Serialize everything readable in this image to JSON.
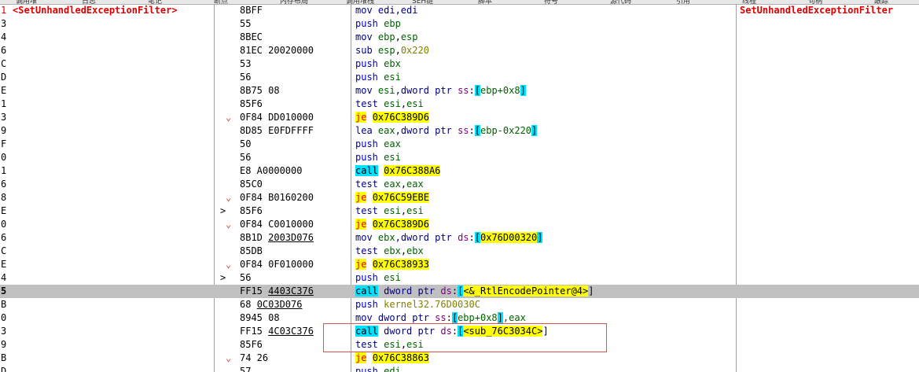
{
  "toolbar": {
    "tabs": [
      "调用堆",
      "日志",
      "笔记",
      "断点",
      "内存布局",
      "调用堆栈",
      "SEH链",
      "脚本",
      "符号",
      "源代码",
      "引用",
      "线程",
      "句柄",
      "跟踪"
    ]
  },
  "comment_header": "SetUnhandledExceptionFilter",
  "rows": [
    {
      "idx": "1",
      "fn": "<SetUnhandledExceptionFilter>",
      "gut": "",
      "hex": [
        {
          "t": "8BFF"
        }
      ],
      "dis": [
        {
          "t": "mov edi,edi",
          "c": "kw"
        }
      ],
      "cmt": "SetUnhandledExceptionFilter"
    },
    {
      "idx": "3",
      "gut": "",
      "hex": [
        {
          "t": "55"
        }
      ],
      "dis": [
        {
          "t": "push ",
          "c": "mn-push"
        },
        {
          "t": "ebp",
          "c": "reg"
        }
      ]
    },
    {
      "idx": "4",
      "gut": "",
      "hex": [
        {
          "t": "8BEC"
        }
      ],
      "dis": [
        {
          "t": "mov ",
          "c": "kw"
        },
        {
          "t": "ebp",
          "c": "reg"
        },
        {
          "t": ",",
          "c": ""
        },
        {
          "t": "esp",
          "c": "reg"
        }
      ]
    },
    {
      "idx": "6",
      "gut": "",
      "hex": [
        {
          "t": "81EC 20020000"
        }
      ],
      "dis": [
        {
          "t": "sub ",
          "c": "kw"
        },
        {
          "t": "esp",
          "c": "reg"
        },
        {
          "t": ",",
          "c": ""
        },
        {
          "t": "0x220",
          "c": "imm"
        }
      ]
    },
    {
      "idx": "C",
      "gut": "",
      "hex": [
        {
          "t": "53"
        }
      ],
      "dis": [
        {
          "t": "push ",
          "c": "mn-push"
        },
        {
          "t": "ebx",
          "c": "reg"
        }
      ]
    },
    {
      "idx": "D",
      "gut": "",
      "hex": [
        {
          "t": "56"
        }
      ],
      "dis": [
        {
          "t": "push ",
          "c": "mn-push"
        },
        {
          "t": "esi",
          "c": "reg"
        }
      ]
    },
    {
      "idx": "E",
      "gut": "",
      "hex": [
        {
          "t": "8B75 08"
        }
      ],
      "dis": [
        {
          "t": "mov ",
          "c": "kw"
        },
        {
          "t": "esi",
          "c": "reg"
        },
        {
          "t": ",dword ptr ",
          "c": "kw"
        },
        {
          "t": "ss",
          "c": "seg"
        },
        {
          "t": ":",
          "c": ""
        },
        {
          "t": "[",
          "c": "br"
        },
        {
          "t": "ebp+0x8",
          "c": "reg"
        },
        {
          "t": "]",
          "c": "br"
        }
      ]
    },
    {
      "idx": "1",
      "gut": "",
      "hex": [
        {
          "t": "85F6"
        }
      ],
      "dis": [
        {
          "t": "test ",
          "c": "kw"
        },
        {
          "t": "esi",
          "c": "reg"
        },
        {
          "t": ",",
          "c": ""
        },
        {
          "t": "esi",
          "c": "reg"
        }
      ]
    },
    {
      "idx": "3",
      "gut": "⌄",
      "hex": [
        {
          "t": "0F84 DD010000"
        }
      ],
      "dis": [
        {
          "t": "je",
          "c": "tag-je"
        },
        {
          "t": " ",
          "c": ""
        },
        {
          "t": "0x76C389D6",
          "c": "hl"
        }
      ]
    },
    {
      "idx": "9",
      "gut": "",
      "hex": [
        {
          "t": "8D85 E0FDFFFF"
        }
      ],
      "dis": [
        {
          "t": "lea ",
          "c": "kw"
        },
        {
          "t": "eax",
          "c": "reg"
        },
        {
          "t": ",dword ptr ",
          "c": "kw"
        },
        {
          "t": "ss",
          "c": "seg"
        },
        {
          "t": ":",
          "c": ""
        },
        {
          "t": "[",
          "c": "br"
        },
        {
          "t": "ebp-0x220",
          "c": "reg"
        },
        {
          "t": "]",
          "c": "br"
        }
      ]
    },
    {
      "idx": "F",
      "gut": "",
      "hex": [
        {
          "t": "50"
        }
      ],
      "dis": [
        {
          "t": "push ",
          "c": "mn-push"
        },
        {
          "t": "eax",
          "c": "reg"
        }
      ]
    },
    {
      "idx": "0",
      "gut": "",
      "hex": [
        {
          "t": "56"
        }
      ],
      "dis": [
        {
          "t": "push ",
          "c": "mn-push"
        },
        {
          "t": "esi",
          "c": "reg"
        }
      ]
    },
    {
      "idx": "1",
      "gut": "",
      "hex": [
        {
          "t": "E8 A0000000"
        }
      ],
      "dis": [
        {
          "t": "call",
          "c": "tag-call"
        },
        {
          "t": " ",
          "c": ""
        },
        {
          "t": "0x76C388A6",
          "c": "hl"
        }
      ]
    },
    {
      "idx": "6",
      "gut": "",
      "hex": [
        {
          "t": "85C0"
        }
      ],
      "dis": [
        {
          "t": "test ",
          "c": "kw"
        },
        {
          "t": "eax",
          "c": "reg"
        },
        {
          "t": ",",
          "c": ""
        },
        {
          "t": "eax",
          "c": "reg"
        }
      ]
    },
    {
      "idx": "8",
      "gut": "⌄",
      "hex": [
        {
          "t": "0F84 B0160200"
        }
      ],
      "dis": [
        {
          "t": "je",
          "c": "tag-je"
        },
        {
          "t": " ",
          "c": ""
        },
        {
          "t": "0x76C59EBE",
          "c": "hl"
        }
      ]
    },
    {
      "idx": "E",
      "gut": ">",
      "hex": [
        {
          "t": "85F6"
        }
      ],
      "dis": [
        {
          "t": "test ",
          "c": "kw"
        },
        {
          "t": "esi",
          "c": "reg"
        },
        {
          "t": ",",
          "c": ""
        },
        {
          "t": "esi",
          "c": "reg"
        }
      ]
    },
    {
      "idx": "0",
      "gut": "⌄",
      "hex": [
        {
          "t": "0F84 C0010000"
        }
      ],
      "dis": [
        {
          "t": "je",
          "c": "tag-je"
        },
        {
          "t": " ",
          "c": ""
        },
        {
          "t": "0x76C389D6",
          "c": "hl"
        }
      ]
    },
    {
      "idx": "6",
      "gut": "",
      "hex": [
        {
          "t": "8B1D "
        },
        {
          "t": "2003D076",
          "u": true
        }
      ],
      "dis": [
        {
          "t": "mov ",
          "c": "kw"
        },
        {
          "t": "ebx",
          "c": "reg"
        },
        {
          "t": ",dword ptr ",
          "c": "kw"
        },
        {
          "t": "ds",
          "c": "seg"
        },
        {
          "t": ":",
          "c": ""
        },
        {
          "t": "[",
          "c": "br"
        },
        {
          "t": "0x76D00320",
          "c": "hl"
        },
        {
          "t": "]",
          "c": "br"
        }
      ]
    },
    {
      "idx": "C",
      "gut": "",
      "hex": [
        {
          "t": "85DB"
        }
      ],
      "dis": [
        {
          "t": "test ",
          "c": "kw"
        },
        {
          "t": "ebx",
          "c": "reg"
        },
        {
          "t": ",",
          "c": ""
        },
        {
          "t": "ebx",
          "c": "reg"
        }
      ]
    },
    {
      "idx": "E",
      "gut": "⌄",
      "hex": [
        {
          "t": "0F84 0F010000"
        }
      ],
      "dis": [
        {
          "t": "je",
          "c": "tag-je"
        },
        {
          "t": " ",
          "c": ""
        },
        {
          "t": "0x76C38933",
          "c": "hl"
        }
      ]
    },
    {
      "idx": "4",
      "gut": ">",
      "hex": [
        {
          "t": "56"
        }
      ],
      "dis": [
        {
          "t": "push ",
          "c": "mn-push"
        },
        {
          "t": "esi",
          "c": "reg"
        }
      ]
    },
    {
      "idx": "5",
      "sel": true,
      "gut": "",
      "hex": [
        {
          "t": "FF15 "
        },
        {
          "t": "4403C376",
          "u": true
        }
      ],
      "dis": [
        {
          "t": "call",
          "c": "tag-call"
        },
        {
          "t": " dword ptr ",
          "c": "kw"
        },
        {
          "t": "ds",
          "c": "seg"
        },
        {
          "t": ":",
          "c": ""
        },
        {
          "t": "[",
          "c": "br"
        },
        {
          "t": "<&_RtlEncodePointer@4>",
          "c": "hl"
        },
        {
          "t": "]",
          "c": ""
        }
      ]
    },
    {
      "idx": "B",
      "gut": "",
      "hex": [
        {
          "t": "68 "
        },
        {
          "t": "0C03D076",
          "u": true
        }
      ],
      "dis": [
        {
          "t": "push ",
          "c": "mn-push"
        },
        {
          "t": "kernel32.76D0030C",
          "c": "imm"
        }
      ]
    },
    {
      "idx": "0",
      "gut": "",
      "hex": [
        {
          "t": "8945 08"
        }
      ],
      "dis": [
        {
          "t": "mov dword ptr ",
          "c": "kw"
        },
        {
          "t": "ss",
          "c": "seg"
        },
        {
          "t": ":",
          "c": ""
        },
        {
          "t": "[",
          "c": "br"
        },
        {
          "t": "ebp+0x8",
          "c": "reg"
        },
        {
          "t": "]",
          "c": "br"
        },
        {
          "t": ",eax",
          "c": "reg"
        }
      ]
    },
    {
      "idx": "3",
      "gut": "",
      "hex": [
        {
          "t": "FF15 "
        },
        {
          "t": "4C03C376",
          "u": true
        }
      ],
      "dis": [
        {
          "t": "call",
          "c": "tag-call"
        },
        {
          "t": " dword ptr ",
          "c": "kw"
        },
        {
          "t": "ds",
          "c": "seg"
        },
        {
          "t": ":",
          "c": ""
        },
        {
          "t": "[",
          "c": "br"
        },
        {
          "t": "<sub_76C3034C>",
          "c": "hl"
        },
        {
          "t": "]",
          "c": ""
        }
      ]
    },
    {
      "idx": "9",
      "gut": "",
      "hex": [
        {
          "t": "85F6"
        }
      ],
      "dis": [
        {
          "t": "test ",
          "c": "kw"
        },
        {
          "t": "esi",
          "c": "reg"
        },
        {
          "t": ",",
          "c": ""
        },
        {
          "t": "esi",
          "c": "reg"
        }
      ]
    },
    {
      "idx": "B",
      "gut": "⌄",
      "hex": [
        {
          "t": "74 26"
        }
      ],
      "dis": [
        {
          "t": "je",
          "c": "tag-je"
        },
        {
          "t": " ",
          "c": ""
        },
        {
          "t": "0x76C38863",
          "c": "hl"
        }
      ]
    },
    {
      "idx": "D",
      "gut": "",
      "hex": [
        {
          "t": "57"
        }
      ],
      "dis": [
        {
          "t": "push ",
          "c": "mn-push"
        },
        {
          "t": "edi",
          "c": "reg"
        }
      ]
    }
  ]
}
